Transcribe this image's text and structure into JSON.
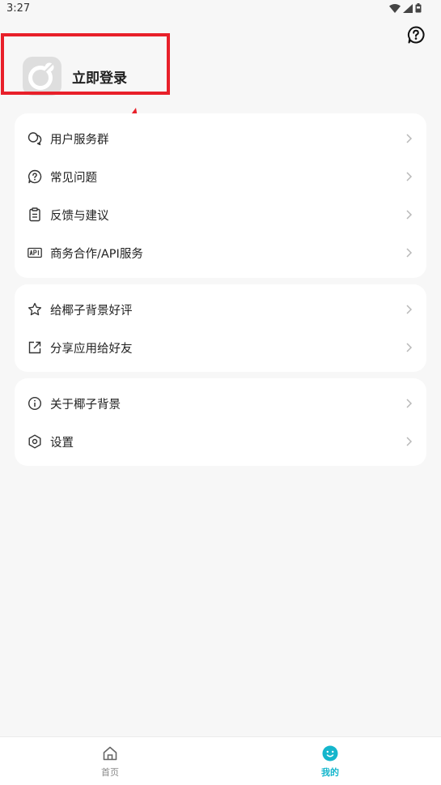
{
  "status_bar": {
    "time": "3:27"
  },
  "header": {
    "help_icon": "question-circle-icon"
  },
  "profile": {
    "login_label": "立即登录",
    "avatar_icon": "app-logo-icon"
  },
  "menu_groups": [
    {
      "items": [
        {
          "label": "用户服务群",
          "icon": "chat-group-icon"
        },
        {
          "label": "常见问题",
          "icon": "question-icon"
        },
        {
          "label": "反馈与建议",
          "icon": "clipboard-icon"
        },
        {
          "label": "商务合作/API服务",
          "icon": "api-icon"
        }
      ]
    },
    {
      "items": [
        {
          "label": "给椰子背景好评",
          "icon": "star-icon"
        },
        {
          "label": "分享应用给好友",
          "icon": "share-icon"
        }
      ]
    },
    {
      "items": [
        {
          "label": "关于椰子背景",
          "icon": "info-icon"
        },
        {
          "label": "设置",
          "icon": "gear-icon"
        }
      ]
    }
  ],
  "bottom_nav": [
    {
      "label": "首页",
      "icon": "home-icon",
      "active": false
    },
    {
      "label": "我的",
      "icon": "smiley-icon",
      "active": true
    }
  ],
  "colors": {
    "accent": "#15b6cc",
    "annotation": "#e8202a",
    "background": "#f7f7f7",
    "card": "#ffffff"
  }
}
